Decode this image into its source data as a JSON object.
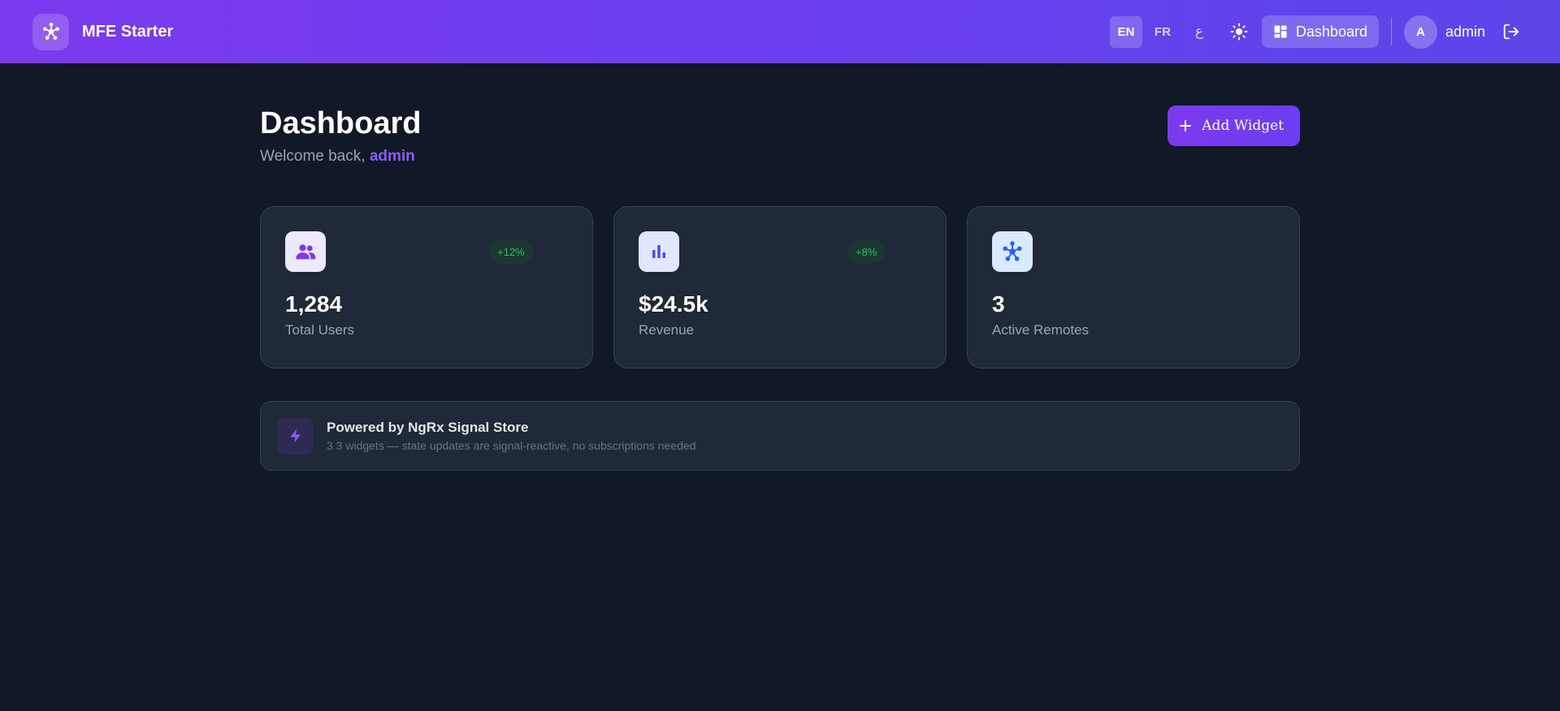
{
  "header": {
    "brand": "MFE Starter",
    "languages": [
      {
        "code": "EN",
        "active": true
      },
      {
        "code": "FR",
        "active": false
      },
      {
        "code": "ع",
        "active": false
      }
    ],
    "theme_icon": "sun-icon",
    "nav_dashboard_label": "Dashboard",
    "avatar_initial": "A",
    "username": "admin",
    "logout_icon": "logout-icon"
  },
  "main": {
    "title": "Dashboard",
    "welcome_prefix": "Welcome back, ",
    "welcome_user": "admin",
    "add_widget_label": "Add Widget",
    "stats": [
      {
        "value": "1,284",
        "label": "Total Users",
        "trend": "+12%",
        "icon": "users-icon",
        "icon_bg": "#ede9fe",
        "icon_color": "#7c3aed"
      },
      {
        "value": "$24.5k",
        "label": "Revenue",
        "trend": "+8%",
        "icon": "bar-chart-icon",
        "icon_bg": "#e0e7ff",
        "icon_color": "#4f46e5"
      },
      {
        "value": "3",
        "label": "Active Remotes",
        "trend": "",
        "icon": "network-icon",
        "icon_bg": "#dbeafe",
        "icon_color": "#2563eb"
      }
    ],
    "info": {
      "title": "Powered by NgRx Signal Store",
      "subtitle": "3 3 widgets — state updates are signal-reactive, no subscriptions needed",
      "icon": "bolt-icon"
    }
  },
  "colors": {
    "accent": "#7c3aed",
    "background": "#111827",
    "card": "#1f2937",
    "trend_positive": "#22c55e"
  }
}
